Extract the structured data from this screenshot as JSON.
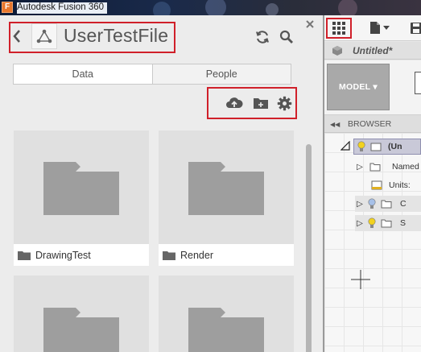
{
  "window": {
    "title": "Autodesk Fusion 360",
    "app_icon_letter": "F"
  },
  "data_panel": {
    "project_title": "UserTestFile",
    "tabs": [
      {
        "label": "Data",
        "active": true
      },
      {
        "label": "People",
        "active": false
      }
    ],
    "items": [
      {
        "name": "DrawingTest",
        "type": "folder"
      },
      {
        "name": "Render",
        "type": "folder"
      },
      {
        "name": "",
        "type": "folder"
      },
      {
        "name": "",
        "type": "folder"
      }
    ]
  },
  "fusion": {
    "document_name": "Untitled*",
    "workspace_button": "MODEL ▾",
    "browser_label": "BROWSER",
    "tree": {
      "root": "(Un",
      "named": "Named",
      "units": "Units:",
      "row_c": "C",
      "row_s": "S"
    }
  },
  "colors": {
    "highlight_box": "#d0202a",
    "folder_grey": "#9e9e9e",
    "titlebar": "#0d1b36"
  }
}
